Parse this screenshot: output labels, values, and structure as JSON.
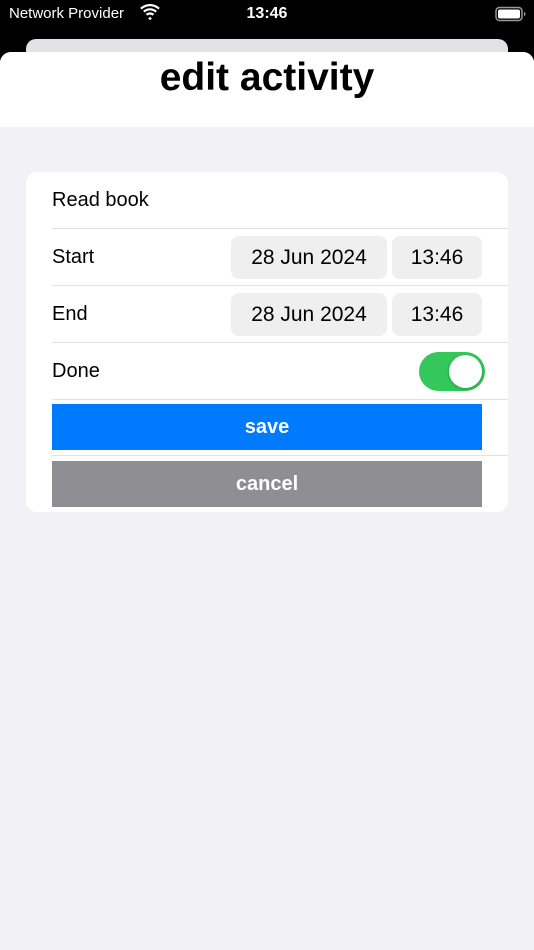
{
  "status_bar": {
    "carrier": "Network Provider",
    "time": "13:46",
    "wifi_icon": "wifi-icon",
    "battery_icon": "battery-icon"
  },
  "header": {
    "title": "edit activity"
  },
  "form": {
    "activity_name": "Read book",
    "start": {
      "label": "Start",
      "date": "28 Jun 2024",
      "time": "13:46"
    },
    "end": {
      "label": "End",
      "date": "28 Jun 2024",
      "time": "13:46"
    },
    "done": {
      "label": "Done",
      "value": true
    },
    "save_label": "save",
    "cancel_label": "cancel"
  },
  "colors": {
    "accent": "#007aff",
    "toggle_on": "#34c759",
    "cancel": "#8e8e93",
    "background": "#f1f1f6"
  }
}
